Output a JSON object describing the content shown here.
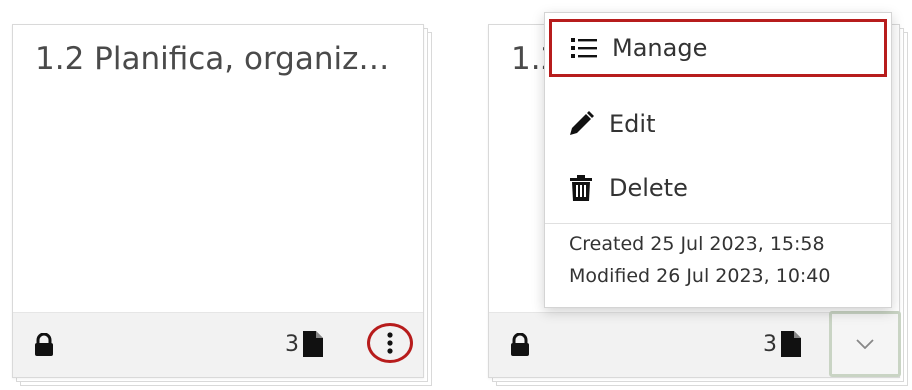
{
  "cards": [
    {
      "title": "1.2 Planifica, organiz…",
      "file_count": "3",
      "icons": {
        "lock": "lock-icon",
        "file": "file-icon",
        "menu": "kebab-menu-icon"
      }
    },
    {
      "title": "1.2",
      "file_count": "3",
      "icons": {
        "lock": "lock-icon",
        "file": "file-icon",
        "toggle": "chevron-down-icon"
      }
    }
  ],
  "menu": {
    "items": [
      {
        "label": "Manage",
        "icon": "list-icon"
      },
      {
        "label": "Edit",
        "icon": "pencil-icon"
      },
      {
        "label": "Delete",
        "icon": "trash-icon"
      }
    ],
    "created": "Created 25 Jul 2023, 15:58",
    "modified": "Modified 26 Jul 2023, 10:40"
  },
  "colors": {
    "highlight": "#b71c1c",
    "footer_bg": "#f2f2f2",
    "toggle_border": "#c9d4c4"
  }
}
